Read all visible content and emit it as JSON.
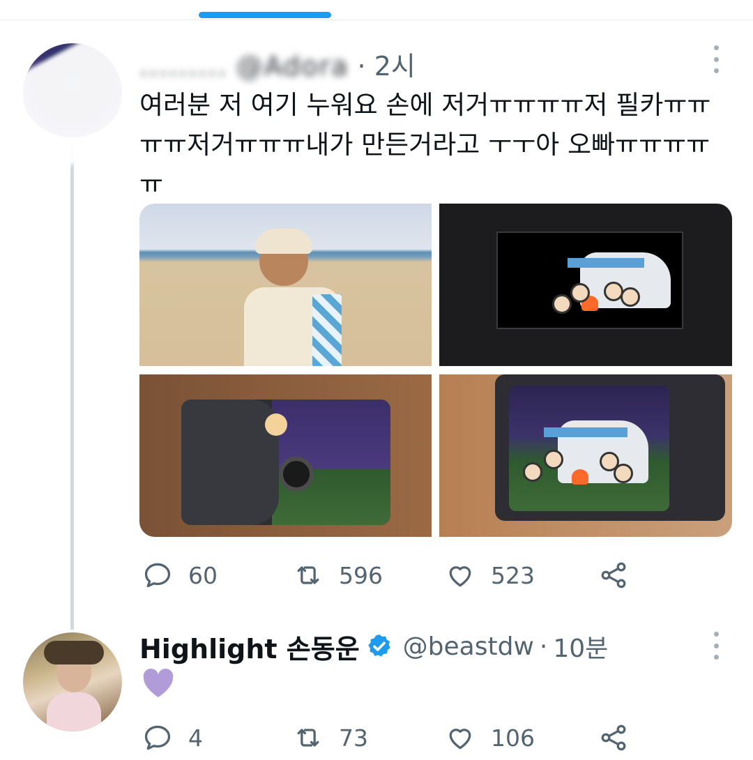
{
  "tweet1": {
    "header_blurred": "",
    "handle_partial": "@Adora",
    "time": "2시",
    "text": "여러분 저 여기 누워요 손에 저거ㅠㅠㅠㅠ저 필카ㅠㅠㅠㅠ저거ㅠㅠㅠ내가 만든거라고 ㅜㅜ아 오빠ㅠㅠㅠㅠㅠ",
    "stats": {
      "replies": "60",
      "retweets": "596",
      "likes": "523"
    }
  },
  "tweet2": {
    "display_name": "Highlight 손동운",
    "handle": "@beastdw",
    "separator": "·",
    "time": "10분",
    "stats": {
      "replies": "4",
      "retweets": "73",
      "likes": "106"
    }
  },
  "icons": {
    "reply": "speech-bubble-icon",
    "retweet": "retweet-icon",
    "like": "heart-icon",
    "share": "share-icon",
    "more": "more-vertical-icon",
    "verified": "verified-badge-icon"
  },
  "colors": {
    "accent": "#1d9bf0",
    "secondary_text": "#536471",
    "primary_text": "#0f1419",
    "heart_emoji": "#b19cd9"
  }
}
